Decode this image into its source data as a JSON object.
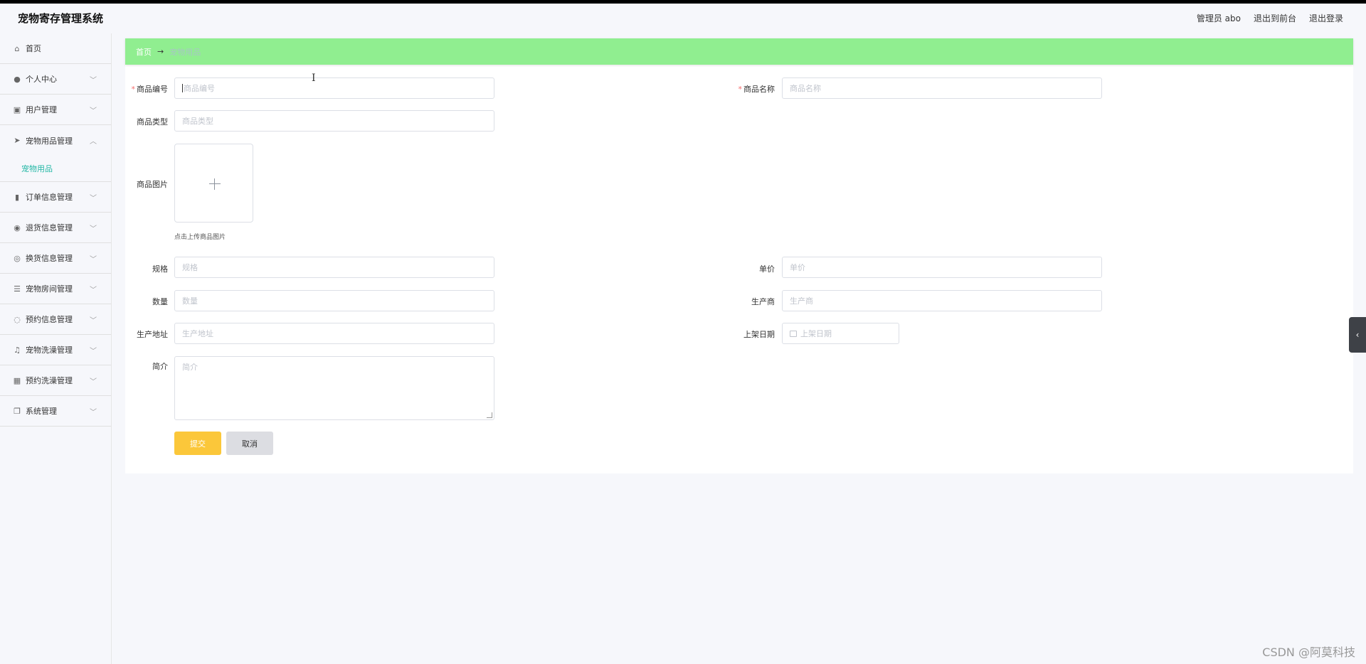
{
  "header": {
    "title": "宠物寄存管理系统",
    "admin": "管理员 abo",
    "to_frontend": "退出到前台",
    "logout": "退出登录"
  },
  "sidebar": {
    "items": [
      {
        "label": "首页",
        "icon": "home-icon"
      },
      {
        "label": "个人中心",
        "icon": "user-icon"
      },
      {
        "label": "用户管理",
        "icon": "clipboard-icon"
      },
      {
        "label": "宠物用品管理",
        "icon": "send-icon"
      },
      {
        "label": "订单信息管理",
        "icon": "chart-icon"
      },
      {
        "label": "退货信息管理",
        "icon": "location-icon"
      },
      {
        "label": "换货信息管理",
        "icon": "compass-icon"
      },
      {
        "label": "宠物房间管理",
        "icon": "sliders-icon"
      },
      {
        "label": "预约信息管理",
        "icon": "circle-icon"
      },
      {
        "label": "宠物洗澡管理",
        "icon": "bell-icon"
      },
      {
        "label": "预约洗澡管理",
        "icon": "grid-icon"
      },
      {
        "label": "系统管理",
        "icon": "copy-icon"
      }
    ],
    "active_sub": "宠物用品"
  },
  "breadcrumb": {
    "home": "首页",
    "arrow": "→",
    "current": "宠物用品"
  },
  "form": {
    "code_label": "商品编号",
    "code_placeholder": "商品编号",
    "name_label": "商品名称",
    "name_placeholder": "商品名称",
    "type_label": "商品类型",
    "type_placeholder": "商品类型",
    "image_label": "商品图片",
    "image_hint": "点击上传商品图片",
    "spec_label": "规格",
    "spec_placeholder": "规格",
    "price_label": "单价",
    "price_placeholder": "单价",
    "qty_label": "数量",
    "qty_placeholder": "数量",
    "maker_label": "生产商",
    "maker_placeholder": "生产商",
    "addr_label": "生产地址",
    "addr_placeholder": "生产地址",
    "date_label": "上架日期",
    "date_placeholder": "上架日期",
    "intro_label": "简介",
    "intro_placeholder": "简介",
    "submit": "提交",
    "cancel": "取消"
  },
  "watermark": "CSDN @阿莫科技"
}
